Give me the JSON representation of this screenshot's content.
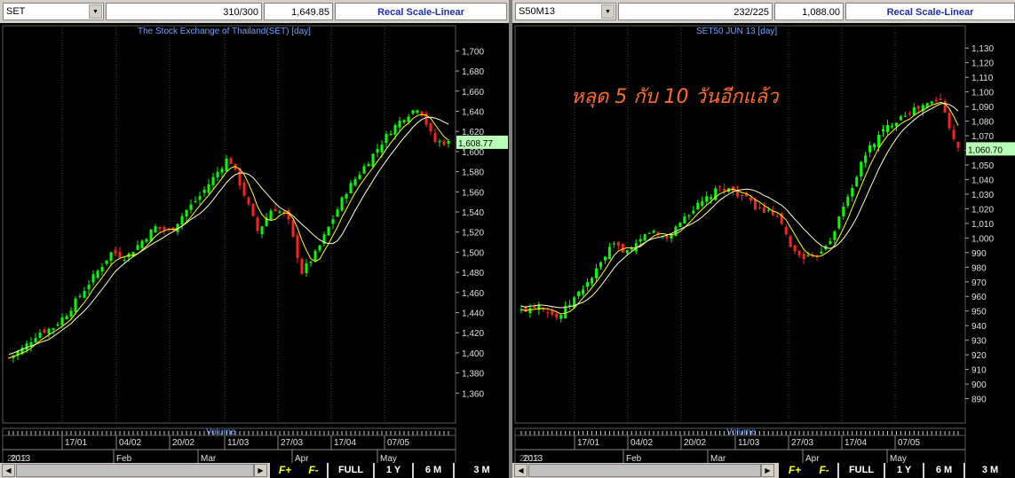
{
  "left": {
    "symbol": "SET",
    "count": "310/300",
    "last": "1,649.85",
    "recal_label": "Recal Scale-Linear",
    "title": "The Stock Exchange of Thailand(SET) [day]",
    "price_label": "1,608.77",
    "axis": [
      "1,700",
      "1,680",
      "1,660",
      "1,640",
      "1,620",
      "1,600",
      "1,580",
      "1,560",
      "1,540",
      "1,520",
      "1,500",
      "1,480",
      "1,460",
      "1,440",
      "1,420",
      "1,400",
      "1,380",
      "1,360"
    ],
    "volume_label": "Volume",
    "dates": [
      "17/01",
      "04/02",
      "20/02",
      "11/03",
      "27/03",
      "17/04",
      "07/05"
    ],
    "months": [
      "2013",
      "Feb",
      "Mar",
      "Apr",
      "May"
    ],
    "year_overlap": "2012",
    "buttons": {
      "f_plus": "F+",
      "f_minus": "F-",
      "full": "FULL",
      "y1": "1 Y",
      "m6": "6 M",
      "m3": "3 M"
    }
  },
  "right": {
    "symbol": "S50M13",
    "count": "232/225",
    "last": "1,088.00",
    "recal_label": "Recal Scale-Linear",
    "title": "SET50 JUN 13  [day]",
    "price_label": "1,060.70",
    "annotation": "หลุด 5 กับ 10 วันอีกแล้ว",
    "axis": [
      "1,130",
      "1,120",
      "1,110",
      "1,100",
      "1,090",
      "1,080",
      "1,070",
      "1,060",
      "1,050",
      "1,040",
      "1,030",
      "1,020",
      "1,010",
      "1,000",
      "990",
      "980",
      "970",
      "960",
      "950",
      "940",
      "930",
      "920",
      "910",
      "900",
      "890"
    ],
    "volume_label": "Volume",
    "dates": [
      "17/01",
      "04/02",
      "20/02",
      "11/03",
      "27/03",
      "17/04",
      "07/05"
    ],
    "months": [
      "2013",
      "Feb",
      "Mar",
      "Apr",
      "May"
    ],
    "year_overlap": "2012",
    "buttons": {
      "f_plus": "F+",
      "f_minus": "F-",
      "full": "FULL",
      "y1": "1 Y",
      "m6": "6 M",
      "m3": "3 M"
    }
  },
  "colors": {
    "up": "#00ff00",
    "down": "#ff2020",
    "ma_fast": "#ffff00",
    "ma_slow": "#ffffcc",
    "title": "#6fa0ff",
    "annotation": "#ff6a2a",
    "price_tag": "#b8ffb8"
  },
  "chart_data": [
    {
      "type": "candlestick",
      "title": "The Stock Exchange of Thailand(SET) [day]",
      "ylim": [
        1340,
        1710
      ],
      "close_estimates": [
        1395,
        1405,
        1420,
        1425,
        1440,
        1460,
        1480,
        1500,
        1495,
        1510,
        1525,
        1520,
        1540,
        1555,
        1575,
        1595,
        1560,
        1520,
        1545,
        1535,
        1480,
        1500,
        1530,
        1560,
        1580,
        1600,
        1620,
        1635,
        1645,
        1610,
        1608.77
      ]
    },
    {
      "type": "candlestick",
      "title": "SET50 JUN 13  [day]",
      "ylim": [
        880,
        1135
      ],
      "close_estimates": [
        950,
        955,
        945,
        960,
        975,
        995,
        990,
        1005,
        1000,
        1015,
        1025,
        1035,
        1030,
        1020,
        1015,
        990,
        985,
        1000,
        1030,
        1060,
        1075,
        1085,
        1090,
        1095,
        1060.7
      ]
    }
  ]
}
